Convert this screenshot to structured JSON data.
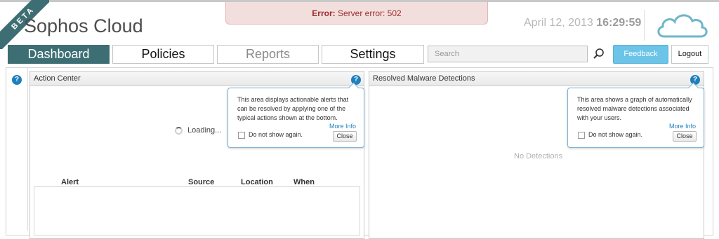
{
  "brand": {
    "ribbon": "BETA",
    "name": "Sophos Cloud"
  },
  "error": {
    "prefix": "Error:",
    "message": "Server error: 502"
  },
  "datetime": {
    "date": "April 12, 2013",
    "time": "16:29:59"
  },
  "nav": {
    "tabs": [
      {
        "label": "Dashboard"
      },
      {
        "label": "Policies"
      },
      {
        "label": "Reports"
      },
      {
        "label": "Settings"
      }
    ],
    "search_placeholder": "Search",
    "feedback_label": "Feedback",
    "logout_label": "Logout"
  },
  "action_center": {
    "title": "Action Center",
    "loading_text": "Loading...",
    "tooltip": {
      "text": "This area displays actionable alerts that can be resolved by applying one of the typical actions shown at the bottom.",
      "more_info": "More Info",
      "checkbox_label": "Do not show again.",
      "close_label": "Close"
    },
    "columns": [
      "Alert",
      "Source",
      "Location",
      "When"
    ]
  },
  "malware": {
    "title": "Resolved Malware Detections",
    "empty_text": "No Detections",
    "tooltip": {
      "text": "This area shows a graph of automatically resolved malware detections associated with your users.",
      "more_info": "More Info",
      "checkbox_label": "Do not show again.",
      "close_label": "Close"
    }
  },
  "help_glyph": "?",
  "colors": {
    "accent": "#3d6e74",
    "feedback": "#6cc4e8",
    "help": "#1f7fbd",
    "error_bg": "#f3dede"
  }
}
